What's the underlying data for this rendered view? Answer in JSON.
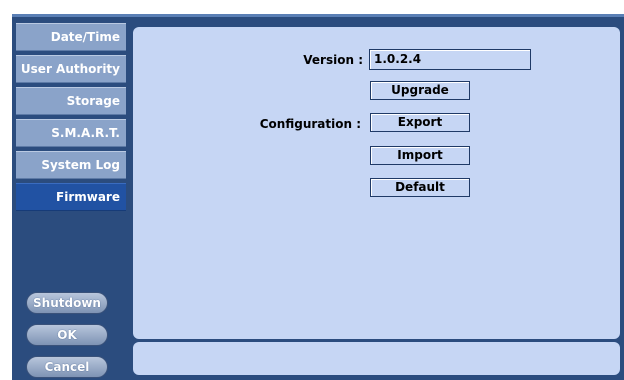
{
  "sidebar": {
    "items": [
      {
        "label": "Date/Time"
      },
      {
        "label": "User Authority"
      },
      {
        "label": "Storage"
      },
      {
        "label": "S.M.A.R.T."
      },
      {
        "label": "System Log"
      },
      {
        "label": "Firmware",
        "active": true
      }
    ]
  },
  "actions": {
    "shutdown": "Shutdown",
    "ok": "OK",
    "cancel": "Cancel"
  },
  "firmware": {
    "version_label": "Version :",
    "version_value": "1.0.2.4",
    "upgrade": "Upgrade",
    "configuration_label": "Configuration :",
    "export": "Export",
    "import": "Import",
    "default": "Default"
  },
  "colors": {
    "frame": "#2b4c7e",
    "panel": "#c6d6f4",
    "sidebar_item": "#8aa3c9",
    "sidebar_active": "#2152a3"
  }
}
